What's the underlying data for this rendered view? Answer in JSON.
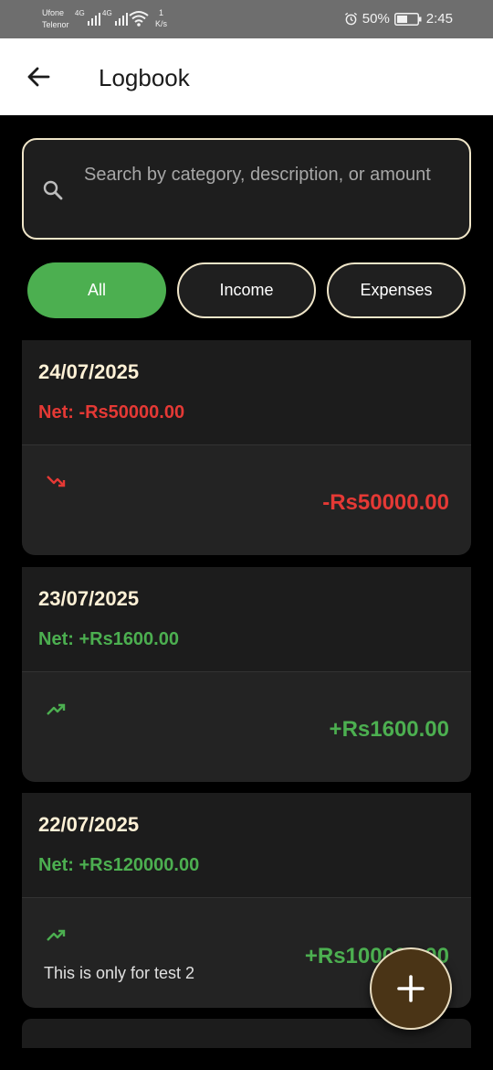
{
  "status_bar": {
    "carrier1": "Ufone",
    "carrier2": "Telenor",
    "network1": "4G",
    "network2": "4G",
    "speed_value": "1",
    "speed_unit": "K/s",
    "battery": "50%",
    "time": "2:45"
  },
  "app_bar": {
    "title": "Logbook",
    "back_icon": "arrow-back-icon"
  },
  "search": {
    "placeholder": "Search by category, description, or amount",
    "icon": "search-icon"
  },
  "filters": [
    {
      "label": "All",
      "selected": true
    },
    {
      "label": "Income",
      "selected": false
    },
    {
      "label": "Expenses",
      "selected": false
    }
  ],
  "days": [
    {
      "date": "24/07/2025",
      "net": "Net: -Rs50000.00",
      "transactions": [
        {
          "icon": "trending-down-icon",
          "amount": "-Rs50000.00",
          "description": ""
        }
      ]
    },
    {
      "date": "23/07/2025",
      "net": "Net: +Rs1600.00",
      "transactions": [
        {
          "icon": "trending-up-icon",
          "amount": "+Rs1600.00",
          "description": ""
        }
      ]
    },
    {
      "date": "22/07/2025",
      "net": "Net: +Rs120000.00",
      "transactions": [
        {
          "icon": "trending-up-icon",
          "amount": "+Rs100000.00",
          "description": "This is only for test 2"
        }
      ]
    }
  ],
  "fab": {
    "icon": "plus-icon"
  },
  "colors": {
    "income": "#4caf50",
    "expense": "#e53935",
    "accent_chip": "#4caf50",
    "fab": "#4a3416",
    "outline": "#efe5c8"
  }
}
